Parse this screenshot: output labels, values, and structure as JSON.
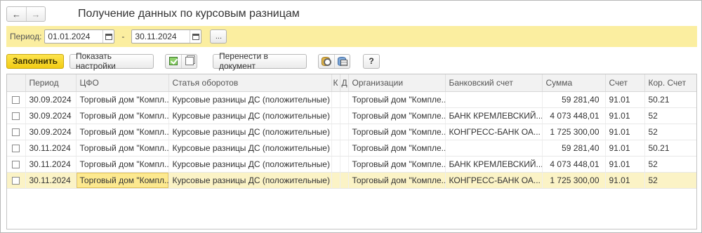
{
  "window": {
    "title": "Получение данных по курсовым разницам",
    "nav_back": "←",
    "nav_forward": "→"
  },
  "period": {
    "label": "Период:",
    "from": "01.01.2024",
    "to": "30.11.2024",
    "dash": "-",
    "more_button": "..."
  },
  "toolbar": {
    "fill_label": "Заполнить",
    "settings_label": "Показать настройки",
    "transfer_label": "Перенести в документ",
    "help_label": "?",
    "icons": [
      "check-all-icon",
      "uncheck-all-icon",
      "db-settings-icon",
      "db-table-icon"
    ]
  },
  "table": {
    "columns": [
      "",
      "Период",
      "ЦФО",
      "Статья оборотов",
      "К",
      "Д",
      "Организации",
      "Банковский счет",
      "Сумма",
      "Счет",
      "Кор. Счет"
    ],
    "rows": [
      {
        "period": "30.09.2024",
        "cfo": "Торговый дом \"Компл...",
        "article": "Курсовые разницы ДС (положительные)",
        "k": "",
        "d": "",
        "org": "Торговый дом \"Компле...",
        "bank": "",
        "sum": "59 281,40",
        "acc": "91.01",
        "cor": "50.21"
      },
      {
        "period": "30.09.2024",
        "cfo": "Торговый дом \"Компл...",
        "article": "Курсовые разницы ДС (положительные)",
        "k": "",
        "d": "",
        "org": "Торговый дом \"Компле...",
        "bank": "БАНК КРЕМЛЕВСКИЙ...",
        "sum": "4 073 448,01",
        "acc": "91.01",
        "cor": "52"
      },
      {
        "period": "30.09.2024",
        "cfo": "Торговый дом \"Компл...",
        "article": "Курсовые разницы ДС (положительные)",
        "k": "",
        "d": "",
        "org": "Торговый дом \"Компле...",
        "bank": "КОНГРЕСС-БАНК ОА...",
        "sum": "1 725 300,00",
        "acc": "91.01",
        "cor": "52"
      },
      {
        "period": "30.11.2024",
        "cfo": "Торговый дом \"Компл...",
        "article": "Курсовые разницы ДС (положительные)",
        "k": "",
        "d": "",
        "org": "Торговый дом \"Компле...",
        "bank": "",
        "sum": "59 281,40",
        "acc": "91.01",
        "cor": "50.21"
      },
      {
        "period": "30.11.2024",
        "cfo": "Торговый дом \"Компл...",
        "article": "Курсовые разницы ДС (положительные)",
        "k": "",
        "d": "",
        "org": "Торговый дом \"Компле...",
        "bank": "БАНК КРЕМЛЕВСКИЙ...",
        "sum": "4 073 448,01",
        "acc": "91.01",
        "cor": "52"
      },
      {
        "period": "30.11.2024",
        "cfo": "Торговый дом \"Компл...",
        "article": "Курсовые разницы ДС (положительные)",
        "k": "",
        "d": "",
        "org": "Торговый дом \"Компле...",
        "bank": "КОНГРЕСС-БАНК ОА...",
        "sum": "1 725 300,00",
        "acc": "91.01",
        "cor": "52"
      }
    ],
    "selected_row": 5
  },
  "colors": {
    "period_bar": "#fbeea0",
    "primary_button": "#f2cc13",
    "selected_row": "#fbf3c6"
  }
}
